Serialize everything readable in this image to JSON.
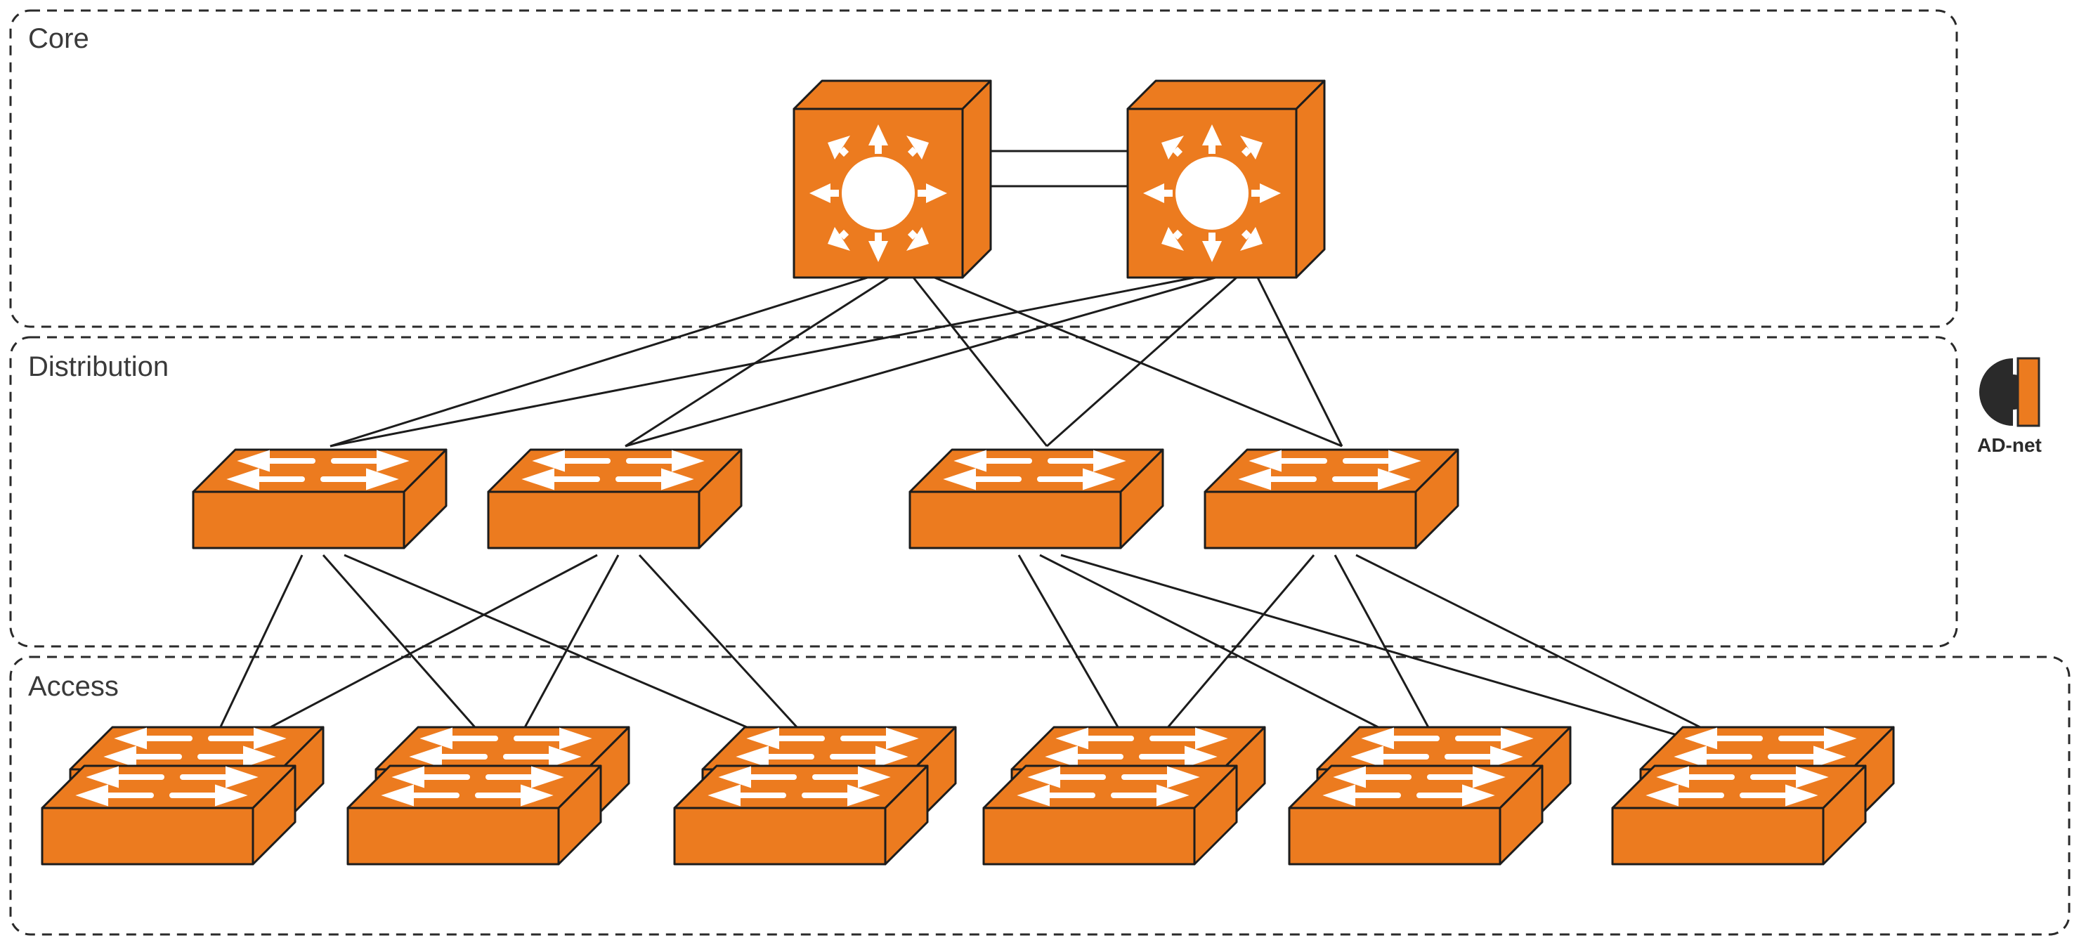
{
  "layers": {
    "core": {
      "label": "Core"
    },
    "distribution": {
      "label": "Distribution"
    },
    "access": {
      "label": "Access"
    }
  },
  "logo": {
    "text": "AD-net"
  },
  "colors": {
    "device_fill": "#ec7b1f",
    "device_stroke": "#1c1c1c",
    "icon": "#ffffff",
    "box_stroke": "#2a2a2a",
    "text": "#3a3a3a",
    "background": "#ffffff"
  },
  "topology": {
    "core_nodes": 2,
    "distribution_nodes": 4,
    "access_node_pairs": 6,
    "connections": {
      "core_core_parallel_links": 2,
      "core_to_distribution": "full_mesh",
      "distribution_to_access": "each_distribution_pair_to_three_adjacent_access_pairs"
    }
  }
}
